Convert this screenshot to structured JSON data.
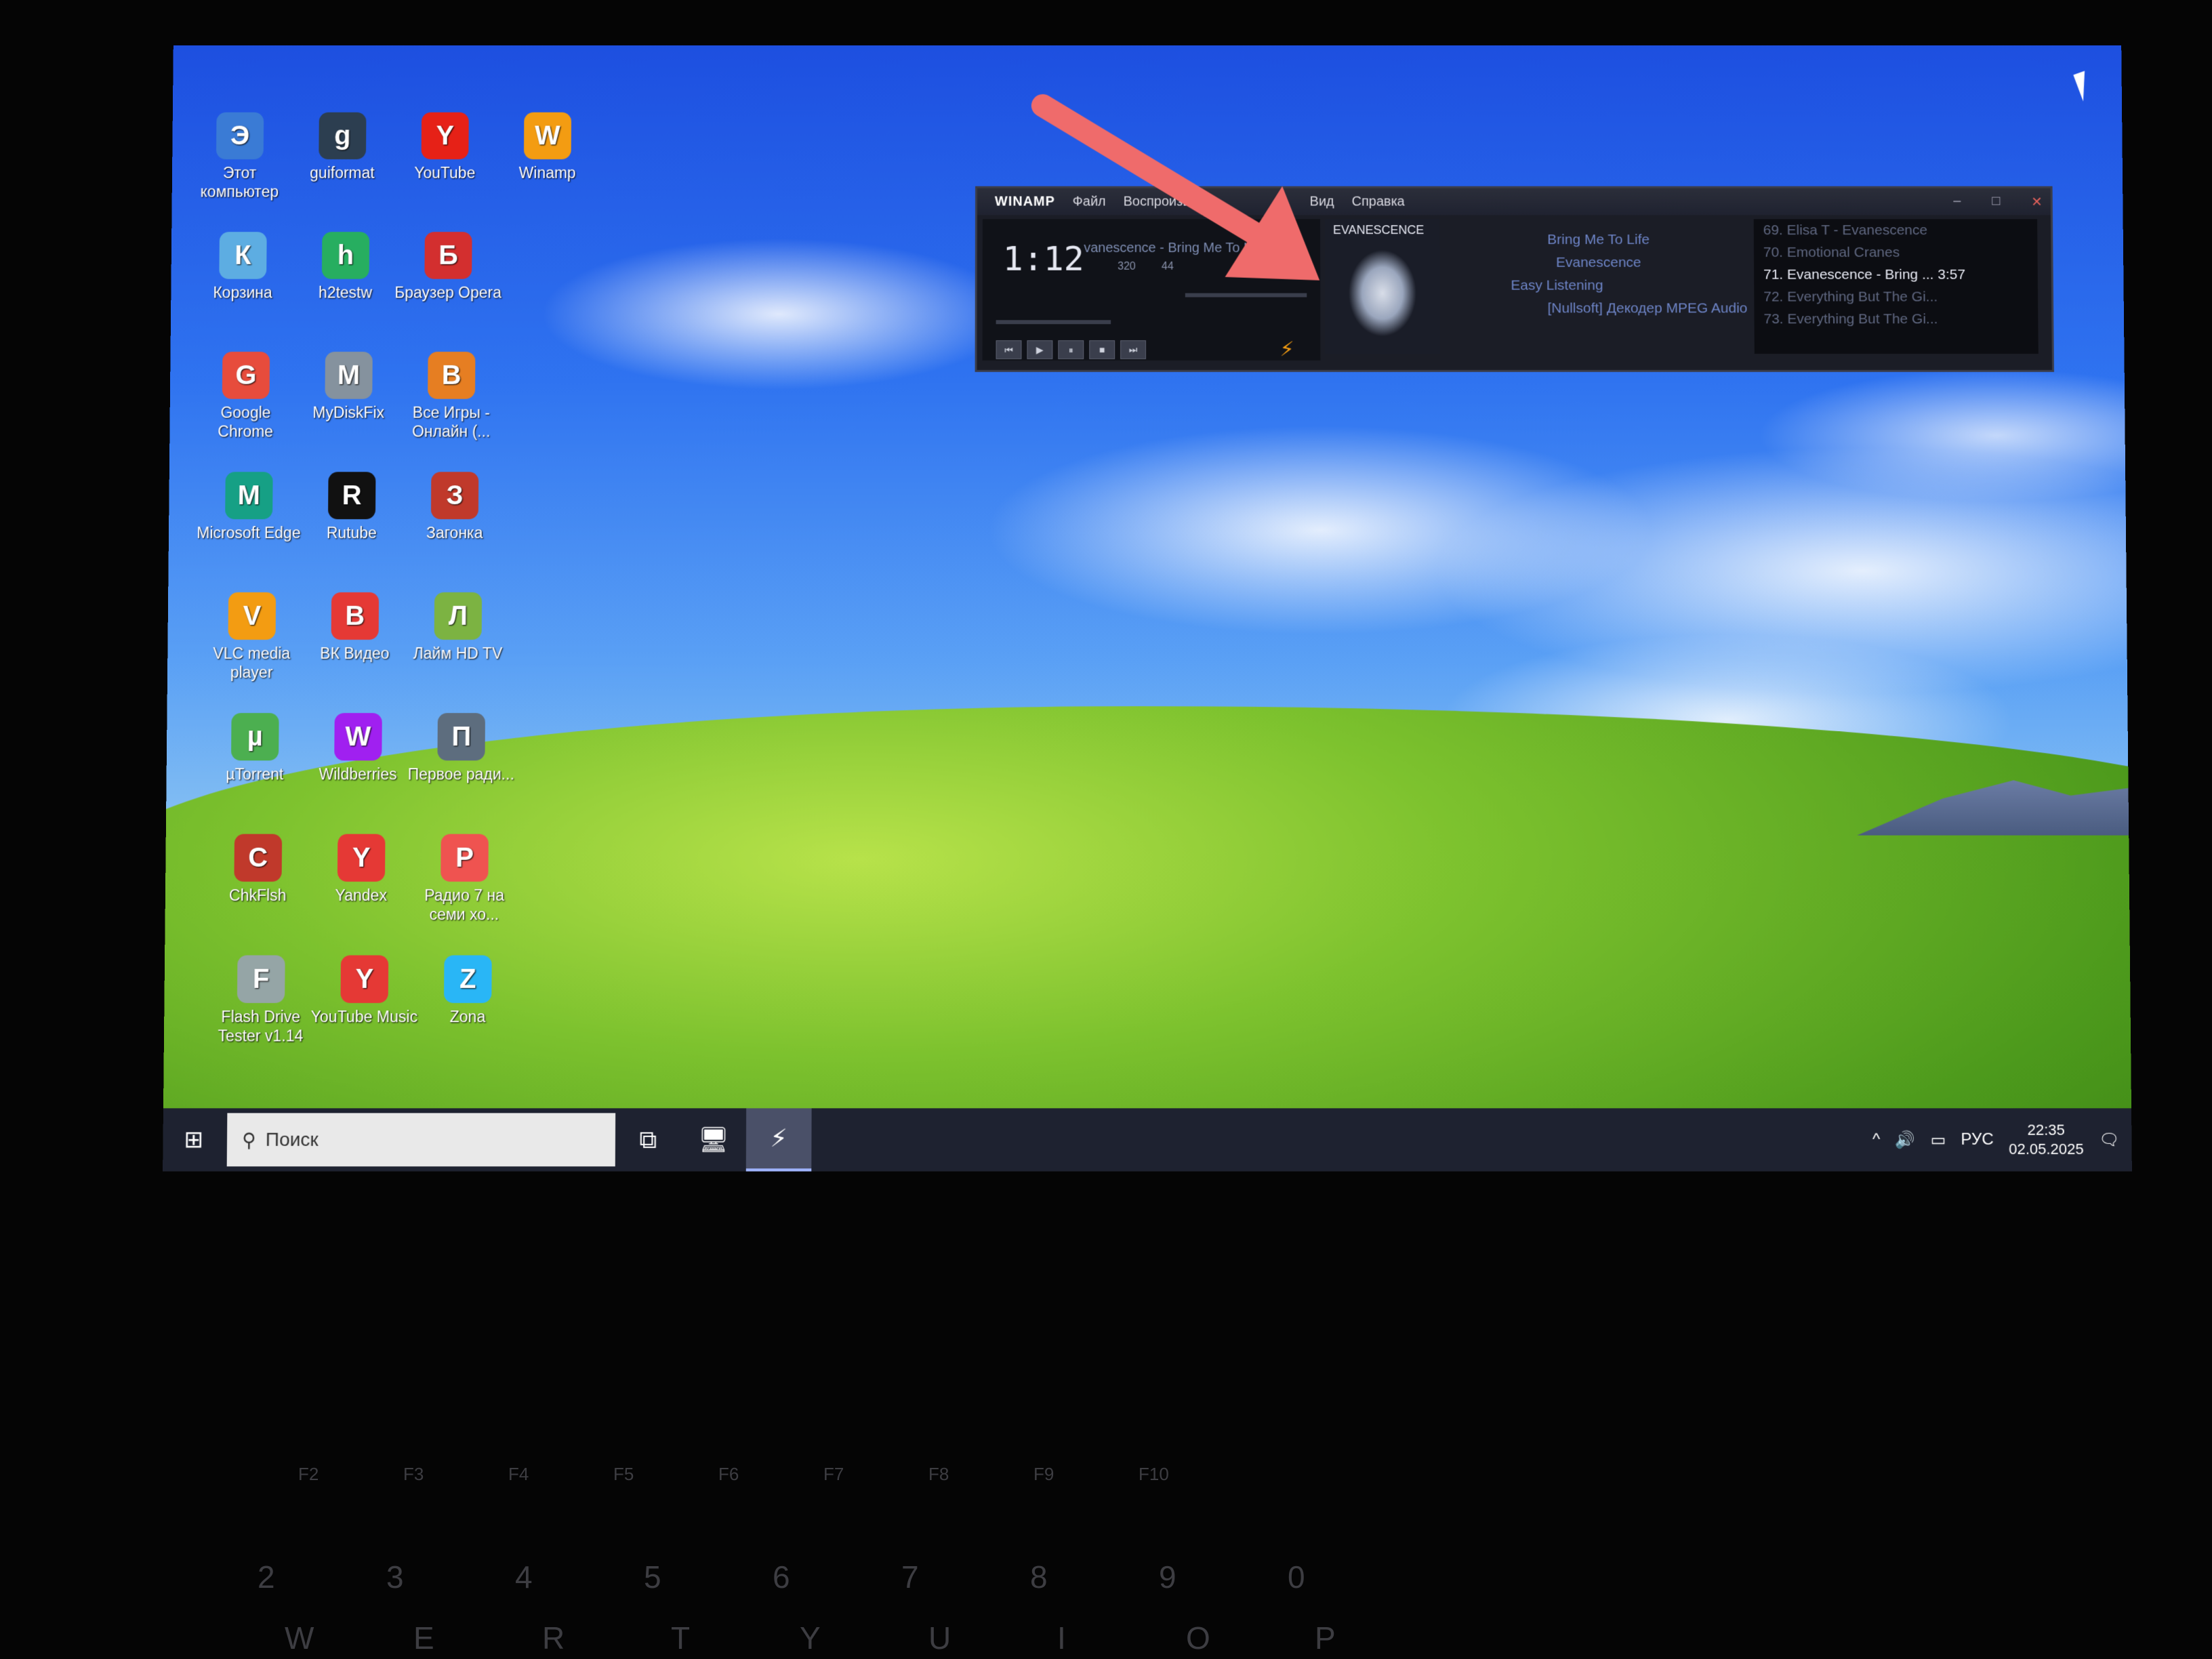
{
  "desktop_icons": [
    {
      "label": "Этот компьютер",
      "icon": "computer-icon",
      "color": "#3a7bd5"
    },
    {
      "label": "guiformat",
      "icon": "format-icon",
      "color": "#2c3e50"
    },
    {
      "label": "YouTube",
      "icon": "youtube-icon",
      "color": "#e62117"
    },
    {
      "label": "Winamp",
      "icon": "winamp-icon",
      "color": "#f39c12"
    },
    {
      "label": "Корзина",
      "icon": "recycle-bin-icon",
      "color": "#5dade2"
    },
    {
      "label": "h2testw",
      "icon": "h2testw-icon",
      "color": "#27ae60"
    },
    {
      "label": "Браузер Opera",
      "icon": "opera-icon",
      "color": "#d32f2f"
    },
    {
      "label": "Google Chrome",
      "icon": "chrome-icon",
      "color": "#e74c3c"
    },
    {
      "label": "MyDiskFix",
      "icon": "magnifier-icon",
      "color": "#85929e"
    },
    {
      "label": "Все Игры - Онлайн (...",
      "icon": "games-icon",
      "color": "#e67e22"
    },
    {
      "label": "Microsoft Edge",
      "icon": "edge-icon",
      "color": "#16a085"
    },
    {
      "label": "Rutube",
      "icon": "rutube-icon",
      "color": "#111111"
    },
    {
      "label": "Загонка",
      "icon": "zagonka-icon",
      "color": "#c0392b"
    },
    {
      "label": "VLC media player",
      "icon": "vlc-icon",
      "color": "#f39c12"
    },
    {
      "label": "ВК Видео",
      "icon": "vk-video-icon",
      "color": "#e53935"
    },
    {
      "label": "Лайм HD TV",
      "icon": "lime-tv-icon",
      "color": "#7cb342"
    },
    {
      "label": "µTorrent",
      "icon": "utorrent-icon",
      "color": "#4caf50"
    },
    {
      "label": "Wildberries",
      "icon": "wildberries-icon",
      "color": "#a020f0"
    },
    {
      "label": "Первое ради...",
      "icon": "radio-icon",
      "color": "#5d6d7e"
    },
    {
      "label": "ChkFlsh",
      "icon": "usb-icon",
      "color": "#c0392b"
    },
    {
      "label": "Yandex",
      "icon": "yandex-icon",
      "color": "#e53935"
    },
    {
      "label": "Радио 7 на семи хо...",
      "icon": "radio7-icon",
      "color": "#ef5350"
    },
    {
      "label": "Flash Drive Tester v1.14",
      "icon": "flash-drive-icon",
      "color": "#95a5a6"
    },
    {
      "label": "YouTube Music",
      "icon": "youtube-music-icon",
      "color": "#e53935"
    },
    {
      "label": "Zona",
      "icon": "zona-icon",
      "color": "#29b6f6"
    }
  ],
  "winamp": {
    "logo": "WINAMP",
    "menu": [
      "Файл",
      "Воспроизве...",
      "Вид",
      "Справка"
    ],
    "time": "1:12",
    "scroll_title": "vanescence - Bring Me To Life",
    "bitrate": "320",
    "khz": "44",
    "cover_text": "EVANESCENCE",
    "info": [
      "Bring Me To Life",
      "Evanescence",
      "Easy Listening",
      "[Nullsoft] Декодер MPEG Audio"
    ],
    "playlist": [
      {
        "text": "69. Elisa T - Evanescence",
        "current": false
      },
      {
        "text": "70. Emotional Cranes",
        "current": false
      },
      {
        "text": "71. Evanescence - Bring ... 3:57",
        "current": true
      },
      {
        "text": "72. Everything But The Gi...",
        "current": false
      },
      {
        "text": "73. Everything But The Gi...",
        "current": false
      }
    ],
    "controls": [
      "⏮",
      "▶",
      "⏸",
      "■",
      "⏭"
    ]
  },
  "taskbar": {
    "start_icon": "windows-icon",
    "search_placeholder": "Поиск",
    "language": "РУС",
    "time": "22:35",
    "date": "02.05.2025"
  },
  "keyboard": {
    "fkeys": [
      "F2",
      "F3",
      "F4",
      "F5",
      "F6",
      "F7",
      "F8",
      "F9",
      "F10"
    ],
    "numbers": [
      "2",
      "3",
      "4",
      "5",
      "6",
      "7",
      "8",
      "9",
      "0"
    ],
    "letters": [
      "W",
      "E",
      "R",
      "T",
      "Y",
      "U",
      "I",
      "O",
      "P"
    ]
  },
  "colors": {
    "arrow": "#ef6b6b",
    "taskbar": "#1e2230",
    "winamp_bg": "#1b1d26"
  }
}
